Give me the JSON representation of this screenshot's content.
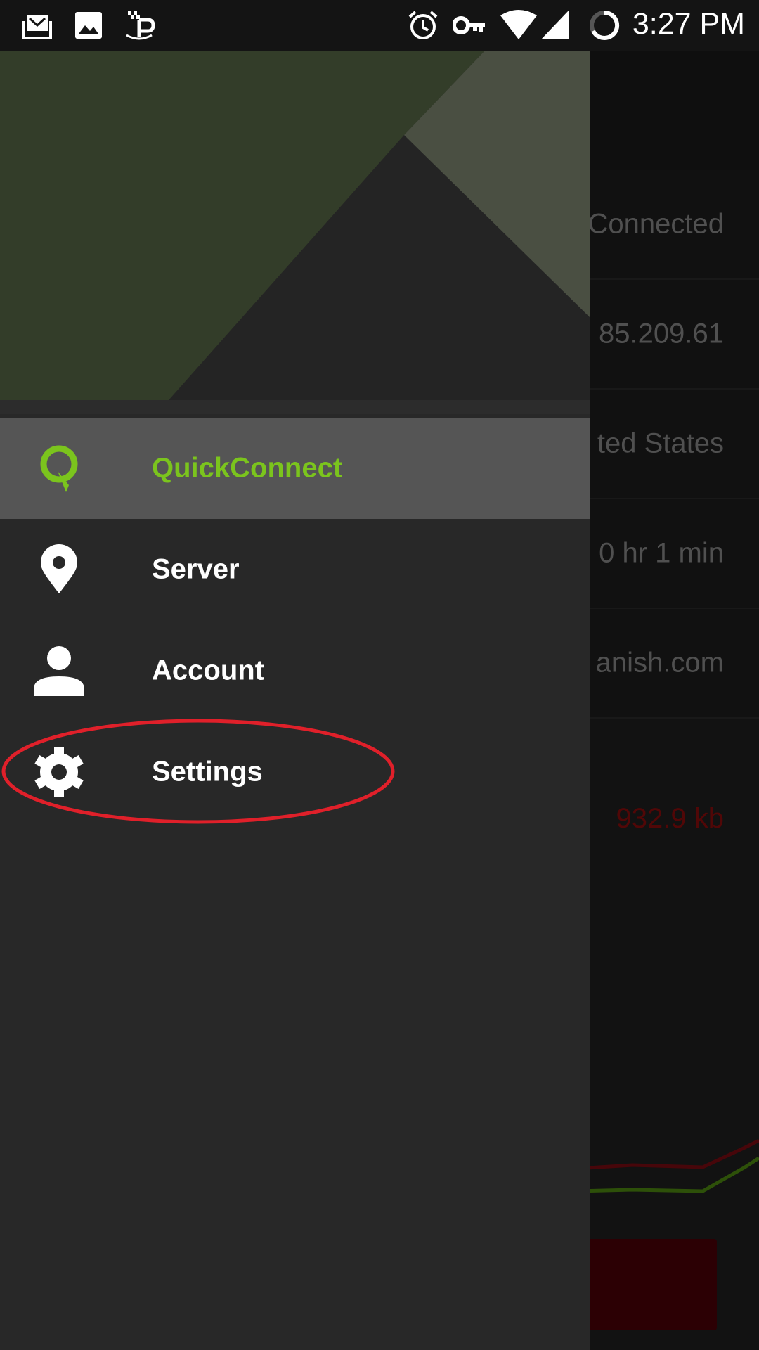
{
  "status_bar": {
    "time": "3:27 PM",
    "icons": [
      "mail-stack-icon",
      "image-icon",
      "ip-vpn-icon",
      "alarm-icon",
      "key-icon",
      "wifi-icon",
      "signal-icon",
      "battery-ring-icon"
    ]
  },
  "background": {
    "rows": [
      "Connected",
      "85.209.61",
      "ted States",
      "0 hr 1 min",
      "anish.com"
    ],
    "data_value": "932.9 kb",
    "colors": {
      "download_line": "#7a0c12",
      "upload_line": "#4f8a10",
      "button": "#4d0008"
    }
  },
  "drawer": {
    "items": [
      {
        "label": "QuickConnect",
        "icon": "quickconnect-icon",
        "active": true
      },
      {
        "label": "Server",
        "icon": "location-pin-icon",
        "active": false
      },
      {
        "label": "Account",
        "icon": "person-icon",
        "active": false
      },
      {
        "label": "Settings",
        "icon": "gear-icon",
        "active": false
      }
    ],
    "colors": {
      "accent": "#7bc41d",
      "active_bg": "#555555",
      "highlight_ring": "#e0202a"
    }
  }
}
